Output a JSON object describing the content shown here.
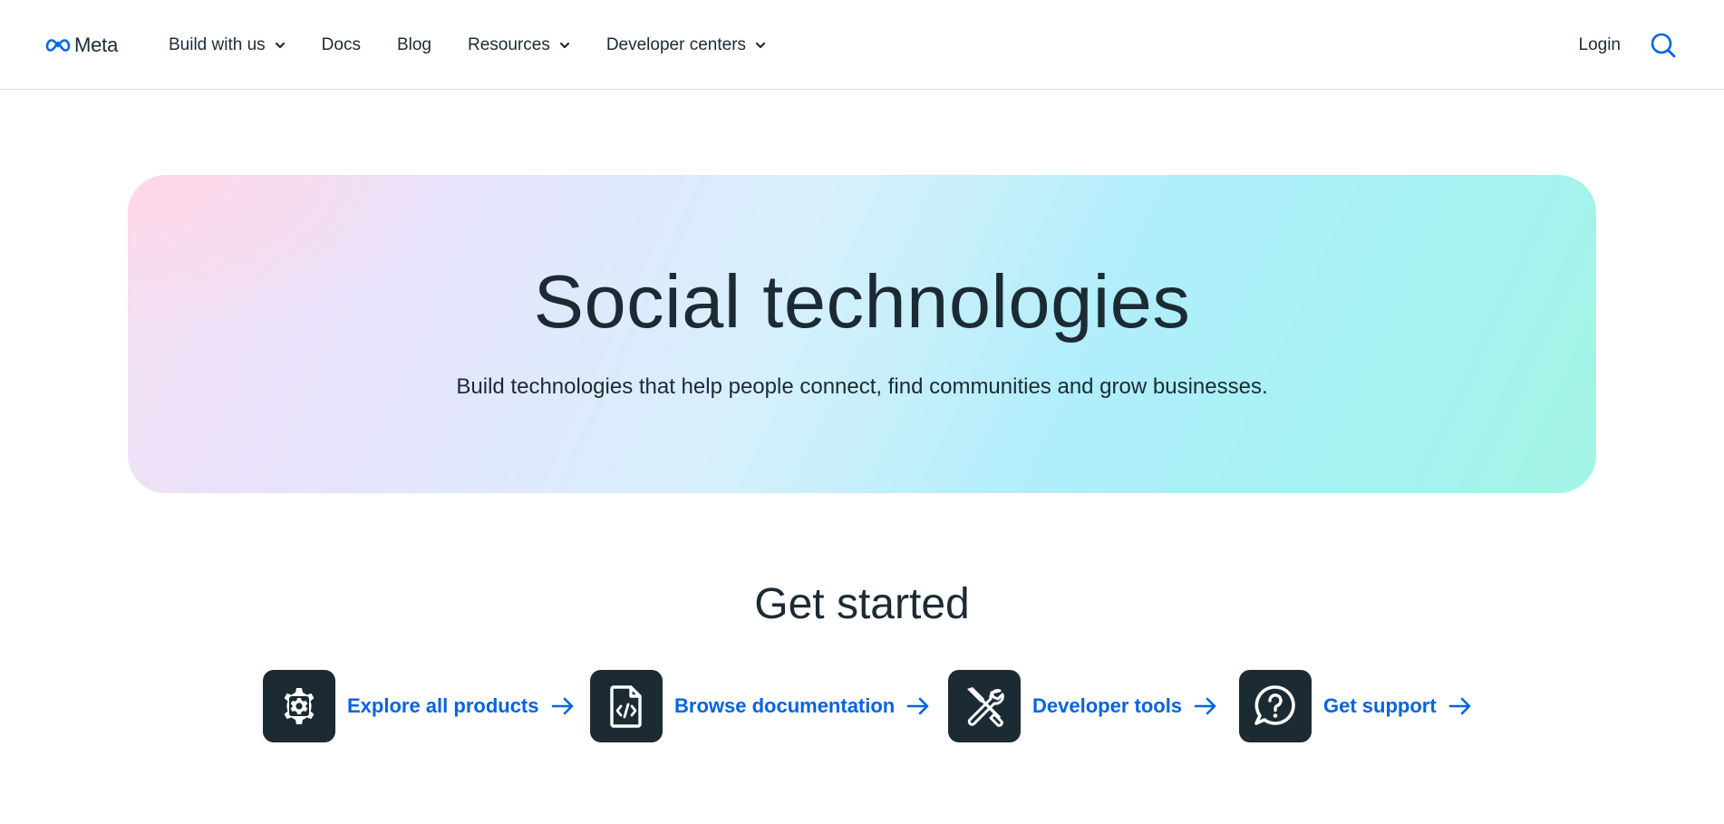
{
  "header": {
    "logo_text": "Meta",
    "nav": [
      {
        "label": "Build with us",
        "has_dropdown": true
      },
      {
        "label": "Docs",
        "has_dropdown": false
      },
      {
        "label": "Blog",
        "has_dropdown": false
      },
      {
        "label": "Resources",
        "has_dropdown": true
      },
      {
        "label": "Developer centers",
        "has_dropdown": true
      }
    ],
    "login_label": "Login",
    "search_icon": "search-icon"
  },
  "hero": {
    "title": "Social technologies",
    "subtitle": "Build technologies that help people connect, find communities and grow businesses."
  },
  "get_started": {
    "heading": "Get started",
    "cards": [
      {
        "label": "Explore all products",
        "icon": "gear-icon"
      },
      {
        "label": "Browse documentation",
        "icon": "code-document-icon"
      },
      {
        "label": "Developer tools",
        "icon": "tools-icon"
      },
      {
        "label": "Get support",
        "icon": "help-bubble-icon"
      }
    ]
  },
  "colors": {
    "text_primary": "#1c2b33",
    "link_blue": "#0064e0",
    "icon_tile": "#1c2b33",
    "meta_logo_blue": "#0668e1"
  }
}
